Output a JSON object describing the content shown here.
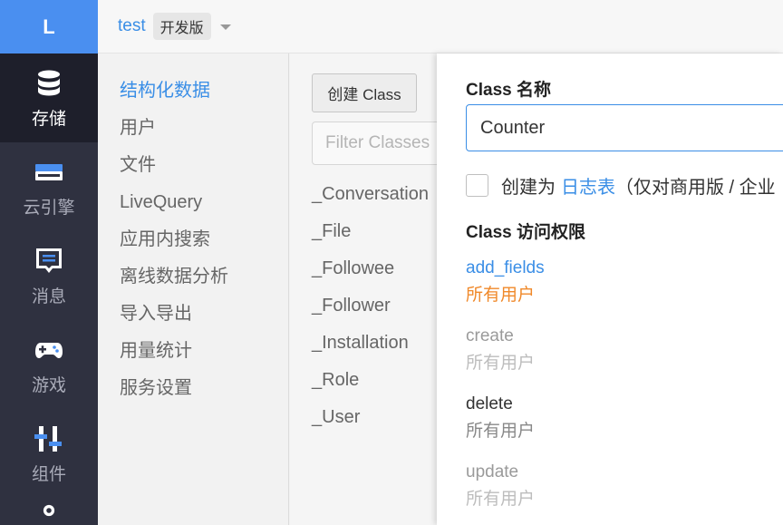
{
  "logo": "L",
  "rail": {
    "items": [
      {
        "label": "存储",
        "icon": "database-icon"
      },
      {
        "label": "云引擎",
        "icon": "server-icon"
      },
      {
        "label": "消息",
        "icon": "chat-icon"
      },
      {
        "label": "游戏",
        "icon": "gamepad-icon"
      },
      {
        "label": "组件",
        "icon": "components-icon"
      },
      {
        "label": "",
        "icon": "gear-icon"
      }
    ]
  },
  "topbar": {
    "app_name": "test",
    "plan": "开发版"
  },
  "subnav": {
    "items": [
      "结构化数据",
      "用户",
      "文件",
      "LiveQuery",
      "应用内搜索",
      "离线数据分析",
      "导入导出",
      "用量统计",
      "服务设置"
    ]
  },
  "classes": {
    "create_label": "创建 Class",
    "filter_placeholder": "Filter Classes",
    "items": [
      "_Conversation",
      "_File",
      "_Followee",
      "_Follower",
      "_Installation",
      "_Role",
      "_User"
    ]
  },
  "panel": {
    "name_label": "Class 名称",
    "name_value": "Counter",
    "log_prefix": "创建为",
    "log_link": "日志表",
    "log_suffix": "（仅对商用版 / 企业",
    "acl_label": "Class 访问权限",
    "permissions": [
      {
        "name": "add_fields",
        "value": "所有用户"
      },
      {
        "name": "create",
        "value": "所有用户"
      },
      {
        "name": "delete",
        "value": "所有用户"
      },
      {
        "name": "update",
        "value": "所有用户"
      }
    ]
  },
  "colors": {
    "accent": "#3a8ee6",
    "warning": "#f0892a",
    "rail_bg": "#2f3140",
    "logo_bg": "#4a8ff0"
  }
}
